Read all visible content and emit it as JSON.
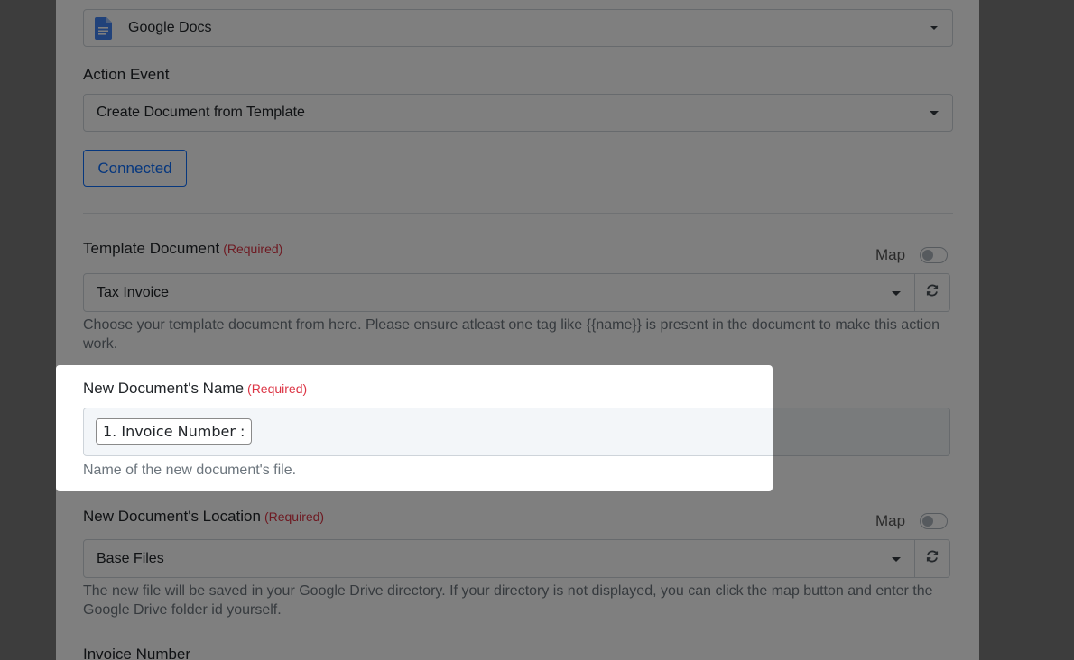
{
  "app_select": {
    "value": "Google Docs"
  },
  "action_event": {
    "label": "Action Event",
    "value": "Create Document from Template"
  },
  "connected_button": {
    "label": "Connected"
  },
  "template_document": {
    "label": "Template Document",
    "required": "(Required)",
    "map_label": "Map",
    "value": "Tax Invoice",
    "help": "Choose your template document from here. Please ensure atleast one tag like {{name}} is present in the document to make this action work."
  },
  "new_document_name": {
    "label": "New Document's Name",
    "required": "(Required)",
    "tag": "1. Invoice Number :",
    "help": "Name of the new document's file."
  },
  "new_document_location": {
    "label": "New Document's Location",
    "required": "(Required)",
    "map_label": "Map",
    "value": "Base Files",
    "help": "The new file will be saved in your Google Drive directory. If your directory is not displayed, you can click the map button and enter the Google Drive folder id yourself."
  },
  "invoice_number": {
    "label": "Invoice Number"
  },
  "colors": {
    "accent": "#0d6efd",
    "required": "#dc3545",
    "google_docs_blue": "#4285f4"
  }
}
